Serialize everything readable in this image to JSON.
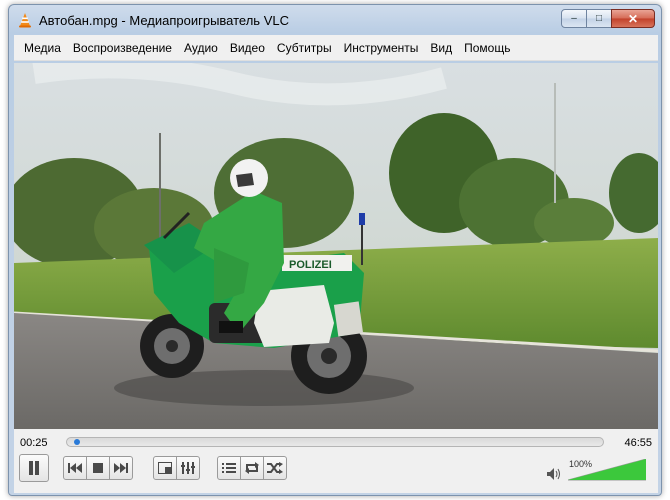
{
  "window": {
    "title": "Автобан.mpg - Медиапроигрыватель VLC",
    "buttons": {
      "minimize": "–",
      "maximize": "□",
      "close": "✕"
    }
  },
  "menu": [
    "Медиа",
    "Воспроизведение",
    "Аудио",
    "Видео",
    "Субтитры",
    "Инструменты",
    "Вид",
    "Помощь"
  ],
  "video": {
    "plate_text": "POLIZEI"
  },
  "controls": {
    "elapsed": "00:25",
    "total": "46:55",
    "progress": 0.009,
    "volume_label": "100%",
    "volume_level": 1.0,
    "icons": [
      "pause-icon",
      "previous-icon",
      "stop-icon",
      "next-icon",
      "fullscreen-icon",
      "extended-settings-icon",
      "playlist-icon",
      "loop-icon",
      "shuffle-icon",
      "speaker-icon"
    ]
  },
  "colors": {
    "accent": "#2a7ad8",
    "volume_fill": "#3cc83c",
    "menu_bg": "#f0f0f0",
    "frame": "#c3d3e6"
  }
}
